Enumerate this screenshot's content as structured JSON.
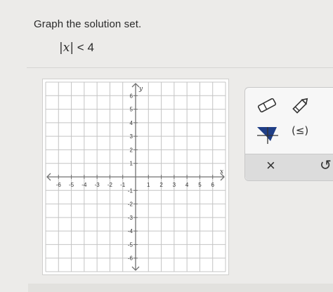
{
  "question": {
    "prompt": "Graph the solution set.",
    "inequality": {
      "bar_left": "|",
      "variable": "x",
      "bar_right": "|",
      "relation": "< 4"
    }
  },
  "graph": {
    "x_axis_label": "x",
    "y_axis_label": "y",
    "x_min": -7,
    "x_max": 7,
    "y_min": -7,
    "y_max": 7,
    "x_ticks": [
      -6,
      -5,
      -4,
      -3,
      -2,
      -1,
      1,
      2,
      3,
      4,
      5,
      6
    ],
    "y_ticks": [
      6,
      5,
      4,
      3,
      2,
      1,
      -1,
      -2,
      -3,
      -4,
      -5,
      -6
    ]
  },
  "toolbar": {
    "tools": [
      "eraser-icon",
      "pencil-icon",
      "shade-region-icon",
      "interval-icon",
      "close-icon",
      "undo-icon"
    ],
    "close_label": "×",
    "undo_label": "↺",
    "interval_label": "(≤)"
  },
  "colors": {
    "grid_line": "#c4c4c4",
    "axis_line": "#707070",
    "shade_tool": "#1f3e86",
    "toolbar_icon": "#333333"
  }
}
